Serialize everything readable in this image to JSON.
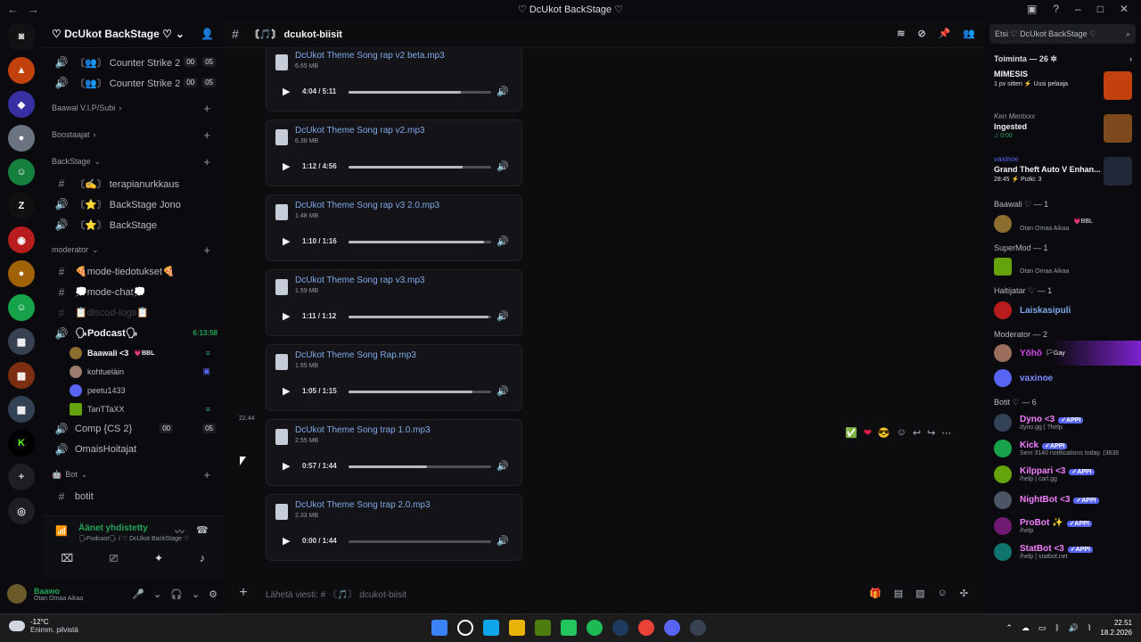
{
  "window": {
    "title": "♡ DcUkot BackStage ♡"
  },
  "server": {
    "name": "♡ DcUkot BackStage ♡"
  },
  "sidebar": {
    "channels_top": [
      {
        "label": "〘👥〙 Counter Strike 2",
        "pill_a": "00",
        "pill_b": "05"
      },
      {
        "label": "〘👥〙 Counter Strike 2",
        "pill_a": "00",
        "pill_b": "05"
      }
    ],
    "categories": {
      "vip": "Baawal V.I.P/Subi",
      "boosters": "Boostaajat",
      "backstage": "BackStage",
      "moderator": "moderator",
      "bot": "Bot"
    },
    "backstage_channels": [
      {
        "label": "〘✍〙 terapianurkkaus"
      },
      {
        "label": "〘⭐〙 BackStage Jono"
      },
      {
        "label": "〘⭐〙 BackStage"
      }
    ],
    "mod_channels": [
      {
        "label": "🍕mode-tiedotukset🍕"
      },
      {
        "label": "💭mode-chat💭"
      },
      {
        "label": "📋discod-logs📋"
      }
    ],
    "podcast": {
      "label": "🗣Podcast🗣",
      "time": "6:13:58"
    },
    "voice_users": [
      {
        "name": "Baawali <3",
        "tag": "💗BBL"
      },
      {
        "name": "kohtuelàin"
      },
      {
        "name": "peetu1433"
      },
      {
        "name": "TanTTaXX"
      }
    ],
    "comp": {
      "label": "Comp {CS 2}",
      "pill_a": "00",
      "pill_b": "05"
    },
    "omais": "OmaisHoitajat",
    "botit": "botit"
  },
  "voice_panel": {
    "status": "Äänet yhdistetty",
    "sub": "🗣Podcast🗣 / ♡ DcUkot BackStage ♡"
  },
  "user_panel": {
    "name": "Baawo",
    "status": "Otan Omaa Aikaa"
  },
  "channel": {
    "name": "〘🎵〙 dcukot-biisit",
    "placeholder": "Lähetä viesti: # 〘🎵〙 dcukot-biisit"
  },
  "attachments": [
    {
      "name": "DcUkot Theme Song rap v2 beta.mp3",
      "size": "6.65 MB",
      "time": "4:04 / 5:11",
      "progress": 0.79
    },
    {
      "name": "DcUkot Theme Song rap v2.mp3",
      "size": "6.38 MB",
      "time": "1:12 / 4:56",
      "progress": 0.8
    },
    {
      "name": "DcUkot Theme Song rap v3 2.0.mp3",
      "size": "1.48 MB",
      "time": "1:10 / 1:16",
      "progress": 0.95
    },
    {
      "name": "DcUkot Theme Song rap v3.mp3",
      "size": "1.59 MB",
      "time": "1:11 / 1:12",
      "progress": 0.98
    },
    {
      "name": "DcUkot Theme Song Rap.mp3",
      "size": "1.65 MB",
      "time": "1:05 / 1:15",
      "progress": 0.87
    },
    {
      "name": "DcUkot Theme Song trap 1.0.mp3",
      "size": "2.55 MB",
      "time": "0:57 / 1:44",
      "progress": 0.55
    },
    {
      "name": "DcUkot Theme Song trap 2.0.mp3",
      "size": "2.33 MB",
      "time": "0:00 / 1:44",
      "progress": 0.0
    }
  ],
  "timestamp": "22.44",
  "members": {
    "search_placeholder": "Etsi ♡ DcUkot BackStage ♡",
    "activity_head": "Toiminta — 26 ✲",
    "activities": [
      {
        "who": "",
        "what": "MIMESIS",
        "meta": "1 pv sitten  ⚡ Uusi pelaaja"
      },
      {
        "who": "Ken Mentxxx",
        "what": "Ingested",
        "meta": "0:00"
      },
      {
        "who": "vaxinoe",
        "what": "Grand Theft Auto V Enhan...",
        "meta": "28:45  ⚡ Putki: 3"
      }
    ],
    "groups": {
      "baawali": "Baawali ♡ — 1",
      "supermod": "SuperMod — 1",
      "haltijatar": "Haltijatar ♡ — 1",
      "moderator": "Moderator — 2",
      "botit": "Botit ♡ — 6"
    },
    "baawali_member": {
      "tag": "💗BBL",
      "status": "Otan Omaa Aikaa"
    },
    "supermod_member": {
      "status": "Otan Omaa Aikaa"
    },
    "haltijatar_member": {
      "name": "Laiskasipuli"
    },
    "mods": [
      {
        "name": "Yōhō",
        "tag": "🏳Gay"
      },
      {
        "name": "vaxinoe"
      }
    ],
    "bots": [
      {
        "name": "Dyno <3",
        "app": "✓APPI",
        "status": "dyno.gg | ?help"
      },
      {
        "name": "Kick",
        "app": "✓APPI",
        "status": "Sent 3140 notifications today. (3636"
      },
      {
        "name": "Kilppari <3",
        "app": "✓APPI",
        "status": "/help | carl.gg"
      },
      {
        "name": "NightBot <3",
        "app": "✓APPI",
        "status": ""
      },
      {
        "name": "ProBot ✨",
        "app": "✓APPI",
        "status": "/help"
      },
      {
        "name": "StatBot <3",
        "app": "✓APPI",
        "status": "/help | statbot.net"
      }
    ]
  },
  "taskbar": {
    "temp": "-12°C",
    "condition": "Enimm. pilvistä",
    "time": "22.51",
    "date": "18.2.2026"
  },
  "colors": {
    "accent": "#5865f2",
    "online": "#23a559",
    "link": "#7fa9e8",
    "bot": "#f47fff"
  }
}
